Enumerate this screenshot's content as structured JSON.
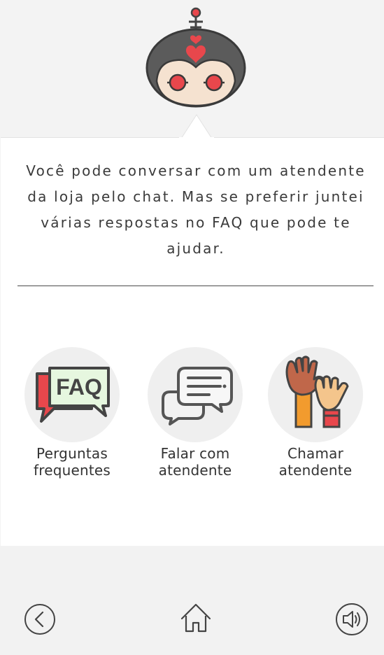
{
  "assistant": {
    "avatar_icon": "robot-mascot-icon",
    "message": "Você pode conversar com um atendente da loja pelo chat. Mas se preferir juntei várias respostas no FAQ que pode te ajudar."
  },
  "options": [
    {
      "icon": "faq-icon",
      "label": "Perguntas frequentes",
      "line1": "Perguntas",
      "line2": "frequentes",
      "icon_text": "FAQ"
    },
    {
      "icon": "chat-bubbles-icon",
      "label": "Falar com atendente",
      "line1": "Falar com",
      "line2": "atendente"
    },
    {
      "icon": "raised-hands-icon",
      "label": "Chamar atendente",
      "line1": "Chamar",
      "line2": "atendente"
    }
  ],
  "nav": {
    "back_icon": "back-arrow-icon",
    "home_icon": "home-icon",
    "sound_icon": "speaker-icon"
  },
  "colors": {
    "background": "#f3f3f3",
    "card": "#ffffff",
    "accent_red": "#e8474c",
    "dark_gray": "#555555",
    "faq_green": "#e6f7df"
  }
}
